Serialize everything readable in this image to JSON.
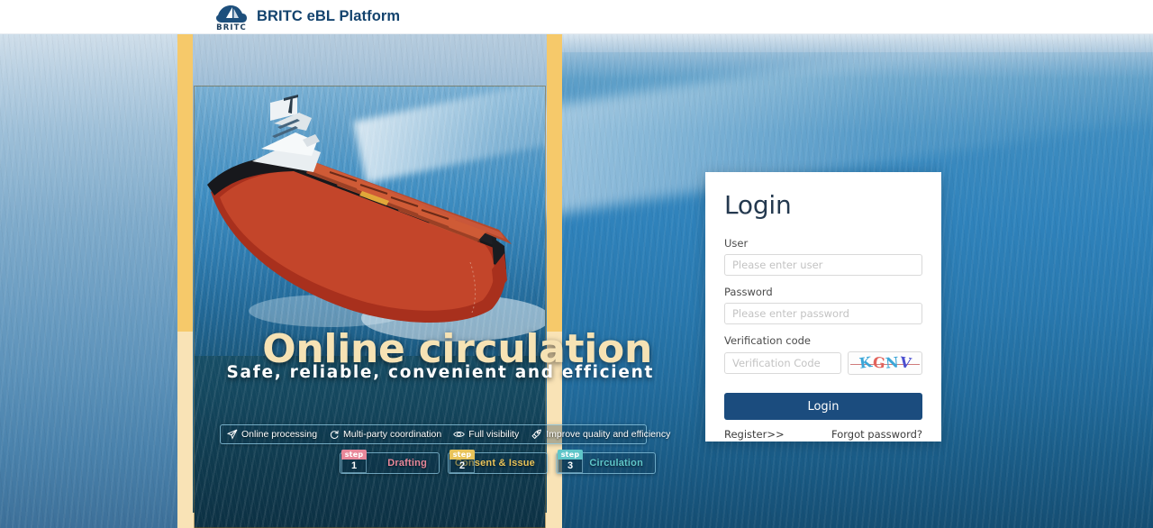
{
  "header": {
    "logo_icon": "britc-wave-sail-logo",
    "logo_text": "BRITC",
    "title": "BRITC eBL Platform"
  },
  "hero": {
    "headline": "Online circulation",
    "subheadline": "Safe, reliable, convenient and efficient",
    "image_alt": "bulk-carrier-ship-at-sea",
    "features": [
      {
        "icon": "send-plane-icon",
        "label": "Online processing"
      },
      {
        "icon": "refresh-circle-icon",
        "label": "Multi-party coordination"
      },
      {
        "icon": "eye-icon",
        "label": "Full visibility"
      },
      {
        "icon": "rocket-icon",
        "label": "Improve quality and efficiency"
      }
    ],
    "steps": [
      {
        "tag": "step",
        "number": "1",
        "label": "Drafting",
        "color": "#e8889a"
      },
      {
        "tag": "step",
        "number": "2",
        "label": "Consent & Issue",
        "color": "#e8c35a"
      },
      {
        "tag": "step",
        "number": "3",
        "label": "Circulation",
        "color": "#5fc6c9"
      }
    ],
    "frame_gold": "#f6c96a",
    "frame_cream": "#f9e3b6"
  },
  "login": {
    "title": "Login",
    "user_label": "User",
    "user_value": "",
    "user_placeholder": "Please enter user",
    "password_label": "Password",
    "password_value": "",
    "password_placeholder": "Please enter password",
    "vcode_label": "Verification code",
    "vcode_value": "",
    "vcode_placeholder": "Verification Code",
    "captcha_text": "KGNV",
    "captcha_chars": [
      "K",
      "G",
      "N",
      "V"
    ],
    "captcha_colors": [
      "#3aa6d8",
      "#e2635c",
      "#3aa6d8",
      "#4b4fd0"
    ],
    "submit_label": "Login",
    "submit_color": "#1b4c7e",
    "register_label": "Register>>",
    "forgot_label": "Forgot password?"
  }
}
